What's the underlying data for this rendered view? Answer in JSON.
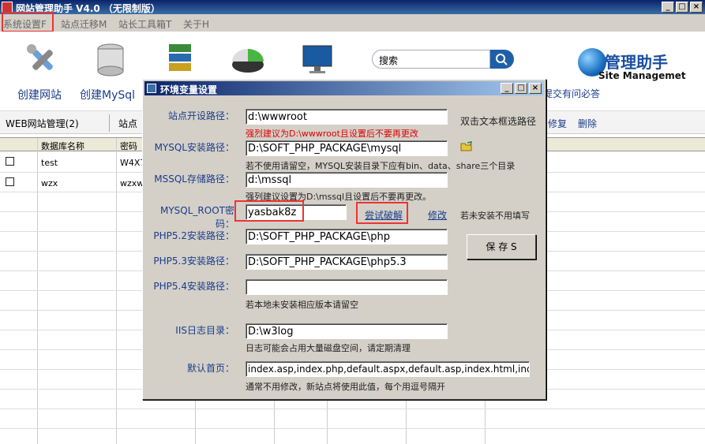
{
  "window": {
    "title": "网站管理助手 V4.0 （无限制版）",
    "controls": [
      "_",
      "□",
      "×"
    ]
  },
  "menu": [
    "系统设置F",
    "站点迁移M",
    "站长工具箱T",
    "关于H"
  ],
  "toolbar": {
    "buttons": [
      "创建网站",
      "创建MySql"
    ]
  },
  "search": {
    "placeholder": "搜索"
  },
  "brand": {
    "title": "管理助手",
    "subtitle": "Site Managemet",
    "help": "提交有问必答"
  },
  "tabs": {
    "web": "WEB网站管理(2)",
    "site": "站点",
    "repair": "修复",
    "delete": "删除"
  },
  "grid": {
    "headers": [
      "数据库名称",
      "密码"
    ],
    "rows": [
      {
        "name": "test",
        "password": "W4X7"
      },
      {
        "name": "wzx",
        "password": "wzxw"
      }
    ]
  },
  "dialog": {
    "title": "环境变量设置",
    "fields": {
      "site_path": {
        "label": "站点开设路径：",
        "value": "d:\\wwwroot",
        "hint": "强烈建议为D:\\wwwroot且设置后不要再更改",
        "side": "双击文本框选路径"
      },
      "mysql_path": {
        "label": "MYSQL安装路径：",
        "value": "D:\\SOFT_PHP_PACKAGE\\mysql",
        "hint": "若不使用请留空，MYSQL安装目录下应有bin、data、share三个目录"
      },
      "mssql_path": {
        "label": "MSSQL存储路径：",
        "value": "d:\\mssql",
        "hint": "强列建议设置为D:\\mssql且设置后不要再更改。"
      },
      "mysql_root": {
        "label": "MYSQL_ROOT密码：",
        "value": "yasbak8z",
        "crack": "尝试破解",
        "modify": "修改",
        "side": "若未安装不用填写"
      },
      "php52": {
        "label": "PHP5.2安装路径：",
        "value": "D:\\SOFT_PHP_PACKAGE\\php"
      },
      "php53": {
        "label": "PHP5.3安装路径：",
        "value": "D:\\SOFT_PHP_PACKAGE\\php5.3"
      },
      "php54": {
        "label": "PHP5.4安装路径：",
        "value": "",
        "hint": "若本地未安装相应版本请留空"
      },
      "iis_log": {
        "label": "IIS日志目录：",
        "value": "D:\\w3log",
        "hint": "日志可能会占用大量磁盘空间，请定期清理"
      },
      "default_page": {
        "label": "默认首页：",
        "value": "index.asp,index.php,default.aspx,default.asp,index.html,index.htm",
        "hint": "通常不用修改，新站点将使用此值，每个用逗号隔开"
      }
    },
    "save": "保 存 S"
  },
  "colors": {
    "title_bar": "#0a246a",
    "dialog_bg": "#d4d0c8",
    "link": "#1a3c8a",
    "warning": "#dd0000",
    "highlight_box": "#ee3333"
  }
}
